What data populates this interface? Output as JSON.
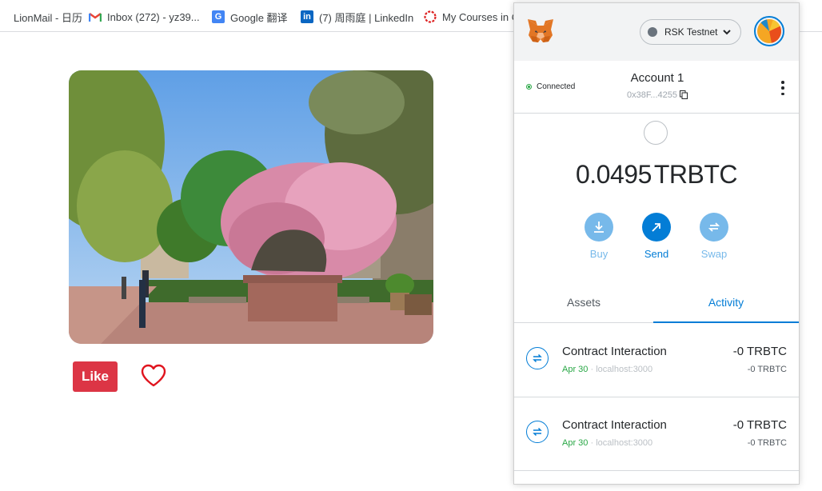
{
  "bookmarks": [
    {
      "label": "LionMail - 日历",
      "icon": "folder-icon"
    },
    {
      "label": "Inbox (272) - yz39...",
      "icon": "gmail-icon"
    },
    {
      "label": "Google 翻译",
      "icon": "google-translate-icon"
    },
    {
      "label": "(7) 周雨庭 | LinkedIn",
      "icon": "linkedin-icon"
    },
    {
      "label": "My Courses in C",
      "icon": "courses-icon"
    }
  ],
  "dapp": {
    "like_label": "Like",
    "heart_icon": "heart-outline-icon"
  },
  "metamask": {
    "network_label": "RSK Testnet",
    "connected_label": "Connected",
    "account_name": "Account 1",
    "account_address": "0x38F...4255",
    "balance_value": "0.0495",
    "balance_currency": "TRBTC",
    "actions": {
      "buy": "Buy",
      "send": "Send",
      "swap": "Swap"
    },
    "tabs": {
      "assets": "Assets",
      "activity": "Activity"
    },
    "transactions": [
      {
        "title": "Contract Interaction",
        "date": "Apr 30",
        "separator": "·",
        "origin": "localhost:3000",
        "amount": "-0 TRBTC",
        "amount_secondary": "-0 TRBTC"
      },
      {
        "title": "Contract Interaction",
        "date": "Apr 30",
        "separator": "·",
        "origin": "localhost:3000",
        "amount": "-0 TRBTC",
        "amount_secondary": "-0 TRBTC"
      }
    ],
    "colors": {
      "primary": "#037dd6",
      "primary_light": "#77b9ea",
      "connected": "#28a745",
      "like_button": "#dc3545"
    }
  }
}
